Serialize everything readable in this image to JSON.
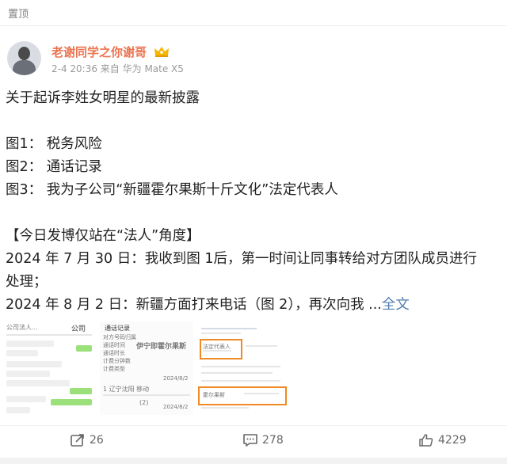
{
  "header": {
    "pinned_label": "置顶"
  },
  "post": {
    "author": "老谢同学之你谢哥",
    "meta": "2-4 20:36 来自 华为 Mate X5",
    "lines": [
      "关于起诉李姓女明星的最新披露",
      "",
      "图1： 税务风险",
      "图2： 通话记录",
      "图3： 我为子公司“新疆霍尔果斯十斤文化”法定代表人",
      "",
      "【今日发博仅站在“法人”角度】",
      "2024 年 7 月 30 日：我收到图 1后，第一时间让同事转给对方团队成员进行",
      "处理；"
    ],
    "last_line": "2024 年 8 月 2 日：新疆方面打来电话（图 2），再次向我 ...",
    "more_link": "全文"
  },
  "images": {
    "img1": {
      "header": "公司",
      "ocr": [
        "公司法人..."
      ]
    },
    "img2": {
      "title": "通话记录",
      "rows": [
        "对方号码归属",
        "通话时间",
        "通话时长",
        "计费分钟数",
        "计费类型"
      ],
      "highlight": "伊宁即霍尔果斯",
      "date1": "2024/8/2",
      "location": "1 辽宁沈阳 移动",
      "date2": "2024/8/2",
      "count": "(2)"
    },
    "img3": {
      "label1": "法定代表人",
      "label2": "霍尔果斯"
    }
  },
  "actions": {
    "repost_count": "26",
    "comment_count": "278",
    "like_count": "4229"
  },
  "colors": {
    "author": "#eb7350",
    "link": "#507daf",
    "badge": "#f7b500"
  }
}
